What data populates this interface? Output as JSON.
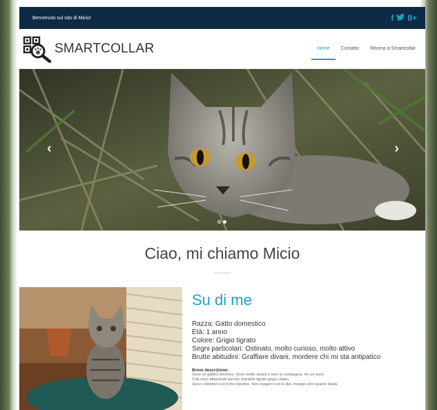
{
  "topbar": {
    "welcome": "Benvenuto sul sito di  Micio!",
    "social": {
      "facebook": "f",
      "twitter": "▲",
      "googleplus": "8+"
    }
  },
  "header": {
    "brand": "SMARTCOLLAR",
    "nav": [
      "Home",
      "Contatto",
      "Ritorna a Smartcollar"
    ]
  },
  "hero": {
    "prev": "‹",
    "next": "›",
    "slides": 2,
    "active_slide": 2
  },
  "intro": {
    "title": "Ciao, mi chiamo Micio"
  },
  "about": {
    "title": "Su di me",
    "details": [
      "Razza: Gatto domestico",
      "Età: 1 anno",
      "Colore: Grigio tigrato",
      "Segni particolari: Ostinato, molto curioso, molto attivo",
      "Brutte abitudini: Graffiare divani, mordere chi mi sta antipatico"
    ],
    "desc_title": "Breve descrizione:",
    "desc_lines": [
      "Sono un gattino birichino. Sono molto vivace e amo la compagnia. Ho un anno.",
      "Tutti sono affascinati dal mio mantello tigrato grigio chiaro.",
      "Gioco volentieri con il mio topolino. Non esagero con il cibo, mangio solo quanto basta."
    ]
  },
  "colors": {
    "accent": "#19a3c4",
    "topbar": "#0e2a45"
  }
}
